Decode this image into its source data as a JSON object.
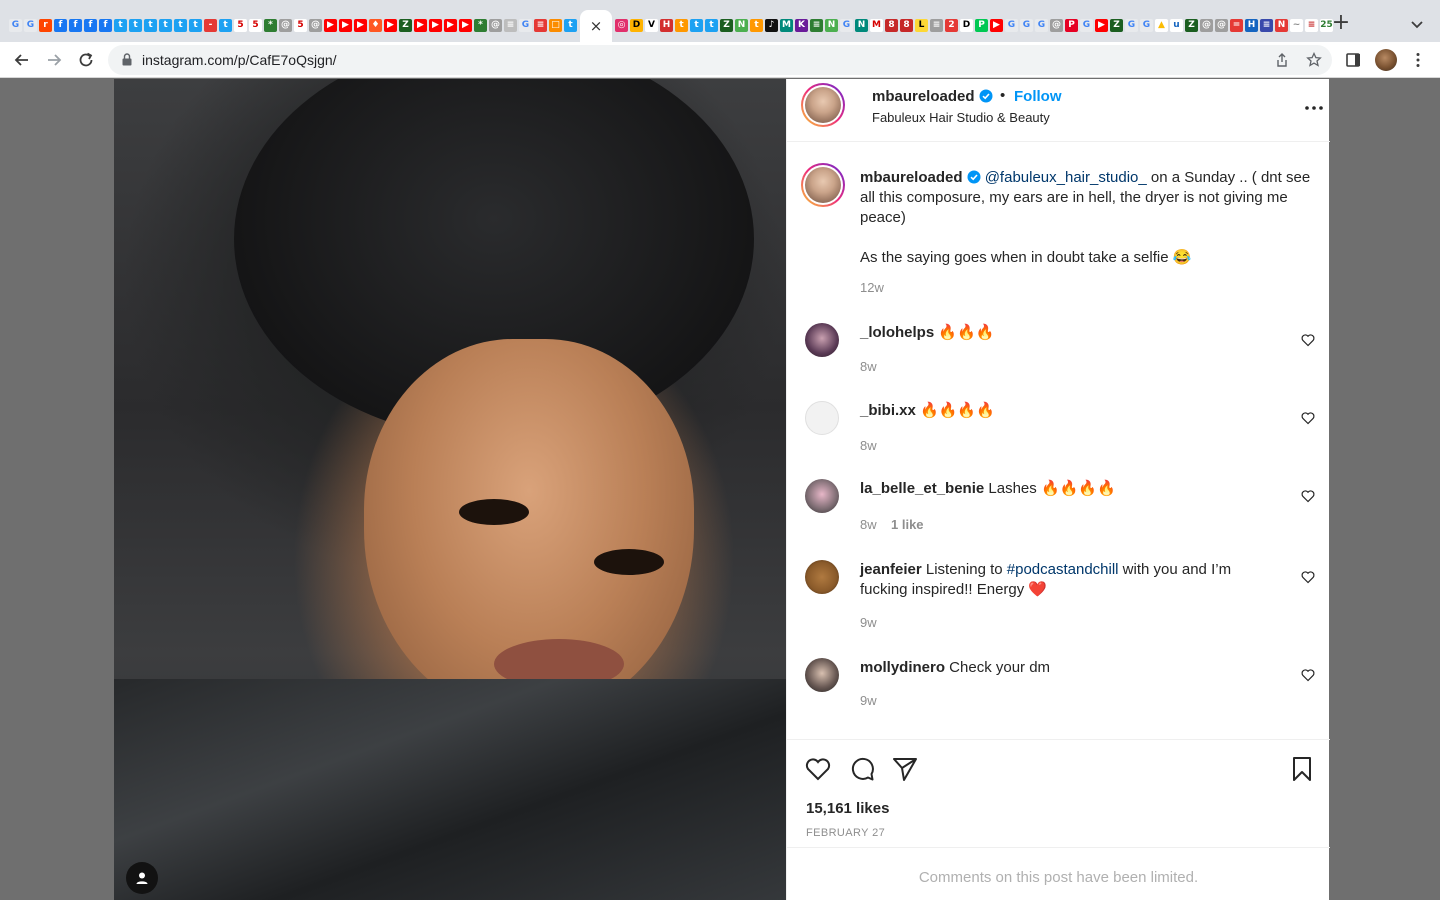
{
  "browser": {
    "favicons": [
      {
        "glyph": "G",
        "bg": "#e8eaed",
        "fg": "#4285f4"
      },
      {
        "glyph": "G",
        "bg": "#e8eaed",
        "fg": "#4285f4"
      },
      {
        "glyph": "r",
        "bg": "#ff4500",
        "fg": "#fff"
      },
      {
        "glyph": "f",
        "bg": "#1877f2",
        "fg": "#fff"
      },
      {
        "glyph": "f",
        "bg": "#1877f2",
        "fg": "#fff"
      },
      {
        "glyph": "f",
        "bg": "#1877f2",
        "fg": "#fff"
      },
      {
        "glyph": "f",
        "bg": "#1877f2",
        "fg": "#fff"
      },
      {
        "glyph": "t",
        "bg": "#1da1f2",
        "fg": "#fff"
      },
      {
        "glyph": "t",
        "bg": "#1da1f2",
        "fg": "#fff"
      },
      {
        "glyph": "t",
        "bg": "#1da1f2",
        "fg": "#fff"
      },
      {
        "glyph": "t",
        "bg": "#1da1f2",
        "fg": "#fff"
      },
      {
        "glyph": "t",
        "bg": "#1da1f2",
        "fg": "#fff"
      },
      {
        "glyph": "t",
        "bg": "#1da1f2",
        "fg": "#fff"
      },
      {
        "glyph": "-",
        "bg": "#e53935",
        "fg": "#fff"
      },
      {
        "glyph": "t",
        "bg": "#1da1f2",
        "fg": "#fff"
      },
      {
        "glyph": "5",
        "bg": "#ffffff",
        "fg": "#d50000"
      },
      {
        "glyph": "5",
        "bg": "#ffffff",
        "fg": "#d50000"
      },
      {
        "glyph": "*",
        "bg": "#2e7d32",
        "fg": "#fff"
      },
      {
        "glyph": "@",
        "bg": "#9e9e9e",
        "fg": "#fff"
      },
      {
        "glyph": "5",
        "bg": "#ffffff",
        "fg": "#d50000"
      },
      {
        "glyph": "@",
        "bg": "#9e9e9e",
        "fg": "#fff"
      },
      {
        "glyph": "▶",
        "bg": "#ff0000",
        "fg": "#fff"
      },
      {
        "glyph": "▶",
        "bg": "#ff0000",
        "fg": "#fff"
      },
      {
        "glyph": "▶",
        "bg": "#ff0000",
        "fg": "#fff"
      },
      {
        "glyph": "♦",
        "bg": "#ff5722",
        "fg": "#fff"
      },
      {
        "glyph": "▶",
        "bg": "#ff0000",
        "fg": "#fff"
      },
      {
        "glyph": "Z",
        "bg": "#1b5e20",
        "fg": "#fff"
      },
      {
        "glyph": "▶",
        "bg": "#ff0000",
        "fg": "#fff"
      },
      {
        "glyph": "▶",
        "bg": "#ff0000",
        "fg": "#fff"
      },
      {
        "glyph": "▶",
        "bg": "#ff0000",
        "fg": "#fff"
      },
      {
        "glyph": "▶",
        "bg": "#ff0000",
        "fg": "#fff"
      },
      {
        "glyph": "*",
        "bg": "#2e7d32",
        "fg": "#fff"
      },
      {
        "glyph": "@",
        "bg": "#9e9e9e",
        "fg": "#fff"
      },
      {
        "glyph": "≡",
        "bg": "#bdbdbd",
        "fg": "#fff"
      },
      {
        "glyph": "G",
        "bg": "#e8eaed",
        "fg": "#4285f4"
      },
      {
        "glyph": "≡",
        "bg": "#e53935",
        "fg": "#fff"
      },
      {
        "glyph": "□",
        "bg": "#fb8c00",
        "fg": "#fff"
      },
      {
        "glyph": "t",
        "bg": "#1da1f2",
        "fg": "#fff"
      }
    ],
    "favicons_right": [
      {
        "glyph": "◎",
        "bg": "#e1306c",
        "fg": "#fff"
      },
      {
        "glyph": "D",
        "bg": "#ffb300",
        "fg": "#000"
      },
      {
        "glyph": "V",
        "bg": "#ffffff",
        "fg": "#000"
      },
      {
        "glyph": "H",
        "bg": "#d32f2f",
        "fg": "#fff"
      },
      {
        "glyph": "t",
        "bg": "#ff9800",
        "fg": "#fff"
      },
      {
        "glyph": "t",
        "bg": "#1da1f2",
        "fg": "#fff"
      },
      {
        "glyph": "t",
        "bg": "#1da1f2",
        "fg": "#fff"
      },
      {
        "glyph": "Z",
        "bg": "#1b5e20",
        "fg": "#fff"
      },
      {
        "glyph": "N",
        "bg": "#4caf50",
        "fg": "#fff"
      },
      {
        "glyph": "t",
        "bg": "#ff9800",
        "fg": "#fff"
      },
      {
        "glyph": "♪",
        "bg": "#111111",
        "fg": "#fff"
      },
      {
        "glyph": "M",
        "bg": "#00897b",
        "fg": "#fff"
      },
      {
        "glyph": "K",
        "bg": "#6a1b9a",
        "fg": "#fff"
      },
      {
        "glyph": "≡",
        "bg": "#2e7d32",
        "fg": "#fff"
      },
      {
        "glyph": "N",
        "bg": "#4caf50",
        "fg": "#fff"
      },
      {
        "glyph": "G",
        "bg": "#e8eaed",
        "fg": "#4285f4"
      },
      {
        "glyph": "N",
        "bg": "#00897b",
        "fg": "#fff"
      },
      {
        "glyph": "M",
        "bg": "#ffffff",
        "fg": "#d50000"
      },
      {
        "glyph": "8",
        "bg": "#c62828",
        "fg": "#fff"
      },
      {
        "glyph": "8",
        "bg": "#c62828",
        "fg": "#fff"
      },
      {
        "glyph": "L",
        "bg": "#fdd835",
        "fg": "#000"
      },
      {
        "glyph": "≡",
        "bg": "#9e9e9e",
        "fg": "#fff"
      },
      {
        "glyph": "2",
        "bg": "#e53935",
        "fg": "#fff"
      },
      {
        "glyph": "D",
        "bg": "#ffffff",
        "fg": "#000"
      },
      {
        "glyph": "P",
        "bg": "#00c853",
        "fg": "#fff"
      },
      {
        "glyph": "▶",
        "bg": "#ff0000",
        "fg": "#fff"
      },
      {
        "glyph": "G",
        "bg": "#e8eaed",
        "fg": "#4285f4"
      },
      {
        "glyph": "G",
        "bg": "#e8eaed",
        "fg": "#4285f4"
      },
      {
        "glyph": "G",
        "bg": "#e8eaed",
        "fg": "#4285f4"
      },
      {
        "glyph": "@",
        "bg": "#9e9e9e",
        "fg": "#fff"
      },
      {
        "glyph": "P",
        "bg": "#e60023",
        "fg": "#fff"
      },
      {
        "glyph": "G",
        "bg": "#e8eaed",
        "fg": "#4285f4"
      },
      {
        "glyph": "▶",
        "bg": "#ff0000",
        "fg": "#fff"
      },
      {
        "glyph": "Z",
        "bg": "#1b5e20",
        "fg": "#fff"
      },
      {
        "glyph": "G",
        "bg": "#e8eaed",
        "fg": "#4285f4"
      },
      {
        "glyph": "G",
        "bg": "#e8eaed",
        "fg": "#4285f4"
      },
      {
        "glyph": "▲",
        "bg": "#ffffff",
        "fg": "#fbbc04"
      },
      {
        "glyph": "u",
        "bg": "#ffffff",
        "fg": "#1565c0"
      },
      {
        "glyph": "Z",
        "bg": "#1b5e20",
        "fg": "#fff"
      },
      {
        "glyph": "@",
        "bg": "#9e9e9e",
        "fg": "#fff"
      },
      {
        "glyph": "@",
        "bg": "#9e9e9e",
        "fg": "#fff"
      },
      {
        "glyph": "=",
        "bg": "#e53935",
        "fg": "#fff"
      },
      {
        "glyph": "H",
        "bg": "#1565c0",
        "fg": "#fff"
      },
      {
        "glyph": "≡",
        "bg": "#3949ab",
        "fg": "#fff"
      },
      {
        "glyph": "N",
        "bg": "#e53935",
        "fg": "#fff"
      },
      {
        "glyph": "~",
        "bg": "#ffffff",
        "fg": "#888"
      },
      {
        "glyph": "≡",
        "bg": "#ffffff",
        "fg": "#c62828"
      },
      {
        "glyph": "25",
        "bg": "#ffffff",
        "fg": "#2e7d32"
      }
    ],
    "active_tab_close": "×",
    "new_tab": "+",
    "url": "instagram.com/p/CafE7oQsjgn/"
  },
  "post": {
    "header": {
      "username": "mbaureloaded",
      "dot": "•",
      "follow_label": "Follow",
      "location": "Fabuleux Hair Studio & Beauty"
    },
    "caption": {
      "username": "mbaureloaded",
      "mention": "@fabuleux_hair_studio_",
      "text_1": " on a Sunday .. ( dnt see all this composure, my ears are in hell, the dryer is not giving me peace)",
      "text_2": "As the saying goes when in doubt take a selfie 😂",
      "time": "12w"
    },
    "comments": [
      {
        "username": "_lolohelps",
        "text": " 🔥🔥🔥",
        "time": "8w",
        "likes": "",
        "avatar_color": "#5a3a55"
      },
      {
        "username": "_bibi.xx",
        "text": " 🔥🔥🔥🔥",
        "time": "8w",
        "likes": "",
        "avatar_color": "#f2f2f2"
      },
      {
        "username": "la_belle_et_benie",
        "text": " Lashes 🔥🔥🔥🔥",
        "time": "8w",
        "likes": "1 like",
        "avatar_color": "#7a6a70"
      },
      {
        "username": "jeanfeier",
        "text_pre": " Listening to ",
        "hashtag": "#podcastandchill",
        "text_post": " with you and I’m fucking inspired!! Energy ❤️",
        "time": "9w",
        "likes": "",
        "avatar_color": "#8a5a2a"
      },
      {
        "username": "mollydinero",
        "text": " Check your dm",
        "time": "9w",
        "likes": "",
        "avatar_color": "#3a3030"
      }
    ],
    "likes": "15,161 likes",
    "date": "FEBRUARY 27",
    "comments_limited": "Comments on this post have been limited."
  }
}
